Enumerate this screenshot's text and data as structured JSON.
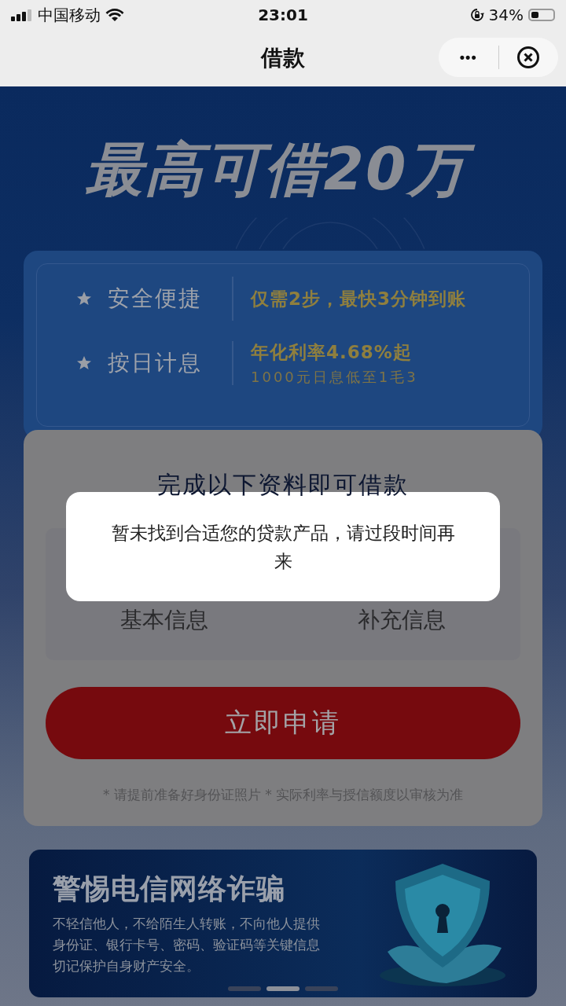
{
  "status_bar": {
    "carrier": "中国移动",
    "time": "23:01",
    "battery": "34%"
  },
  "nav": {
    "title": "借款",
    "more": "•••"
  },
  "hero": {
    "title": "最高可借20万"
  },
  "features": [
    {
      "label": "安全便捷",
      "detail": "仅需2步，最快3分钟到账"
    },
    {
      "label": "按日计息",
      "detail": "年化利率4.68%起",
      "sub": "1000元日息低至1毛3"
    }
  ],
  "form": {
    "title": "完成以下资料即可借款",
    "steps": [
      {
        "label": "基本信息"
      },
      {
        "label": "补充信息"
      }
    ],
    "apply_button": "立即申请",
    "note": "* 请提前准备好身份证照片 * 实际利率与授信额度以审核为准"
  },
  "banner": {
    "title": "警惕电信网络诈骗",
    "text_lines": [
      "不轻信他人，不给陌生人转账，不向他人提供",
      "身份证、银行卡号、密码、验证码等关键信息",
      "切记保护自身财产安全。"
    ],
    "slides": [
      {
        "selected": false
      },
      {
        "selected": true
      },
      {
        "selected": false
      }
    ]
  },
  "toast": {
    "message": "暂未找到合适您的贷款产品，请过段时间再来"
  }
}
